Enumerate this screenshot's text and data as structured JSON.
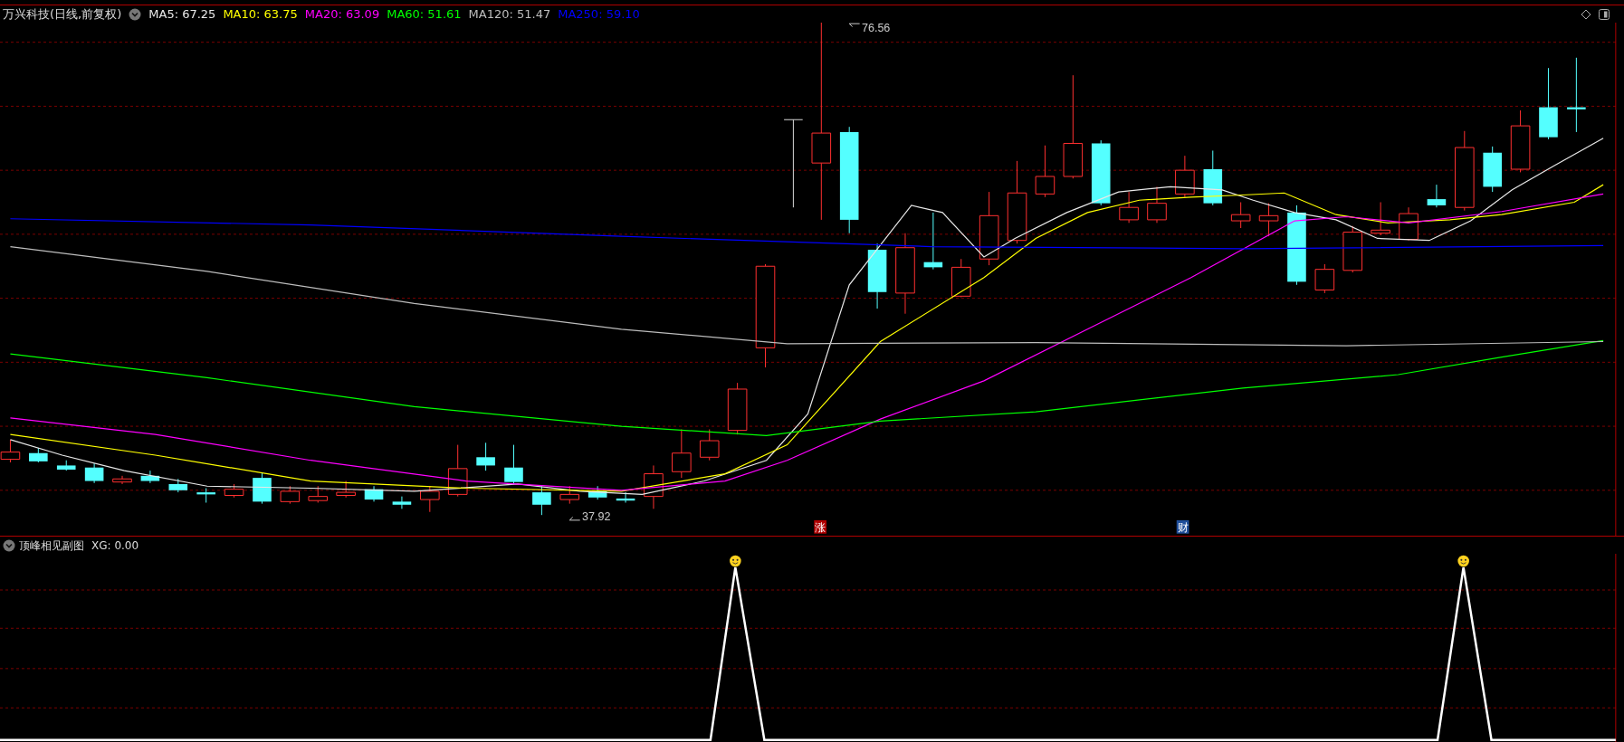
{
  "chart_title": "万兴科技(日线,前复权)",
  "moving_averages": [
    {
      "label": "MA5: 67.25",
      "color": "#e8e8e8"
    },
    {
      "label": "MA10: 63.75",
      "color": "#ffff00"
    },
    {
      "label": "MA20: 63.09",
      "color": "#ff00ff"
    },
    {
      "label": "MA60: 51.61",
      "color": "#00ff00"
    },
    {
      "label": "MA120: 51.47",
      "color": "#bdbdbd"
    },
    {
      "label": "MA250: 59.10",
      "color": "#0000ff"
    }
  ],
  "main_chart": {
    "high_label": "76.56",
    "low_label": "37.92",
    "event_markers": [
      {
        "text": "涨",
        "color": "#b00000"
      },
      {
        "text": "财",
        "color": "#1f4e9a"
      }
    ]
  },
  "sub_panel": {
    "title": "顶峰相见副图",
    "reading": "XG: 0.00"
  }
}
